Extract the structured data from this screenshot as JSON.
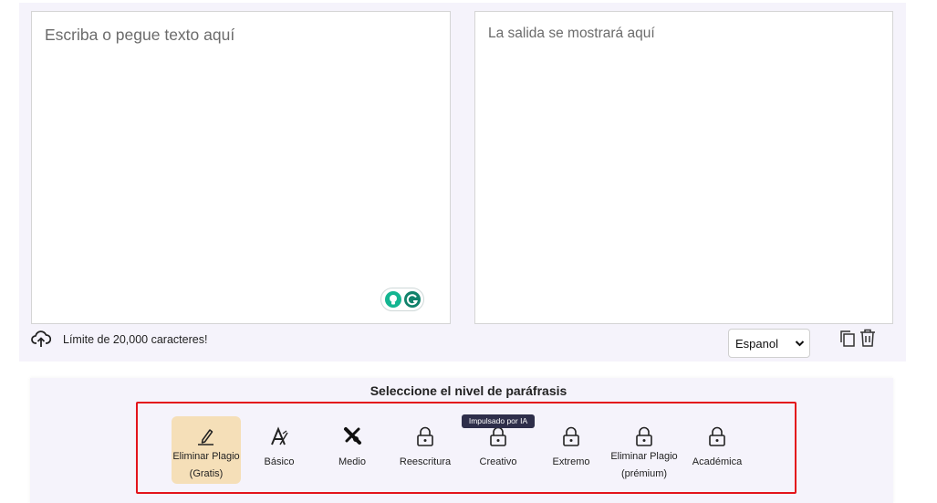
{
  "input": {
    "placeholder": "Escriba o pegue texto aquí"
  },
  "output": {
    "placeholder": "La salida se mostrará aquí"
  },
  "footer": {
    "limit_text": "Límite de 20,000 caracteres!",
    "language": "Espanol"
  },
  "paraphrase": {
    "title": "Seleccione el nivel de paráfrasis",
    "ai_badge": "Impulsado por IA",
    "levels": [
      {
        "line1": "Eliminar Plagio",
        "line2": "(Gratis)",
        "icon": "pen-icon",
        "locked": false,
        "selected": true
      },
      {
        "line1": "Básico",
        "line2": "",
        "icon": "basic-icon",
        "locked": false,
        "selected": false
      },
      {
        "line1": "Medio",
        "line2": "",
        "icon": "medium-icon",
        "locked": false,
        "selected": false
      },
      {
        "line1": "Reescritura",
        "line2": "",
        "icon": "lock-icon",
        "locked": true,
        "selected": false
      },
      {
        "line1": "Creativo",
        "line2": "",
        "icon": "lock-icon",
        "locked": true,
        "selected": false
      },
      {
        "line1": "Extremo",
        "line2": "",
        "icon": "lock-icon",
        "locked": true,
        "selected": false
      },
      {
        "line1": "Eliminar Plagio",
        "line2": "(prémium)",
        "icon": "lock-icon",
        "locked": true,
        "selected": false
      },
      {
        "line1": "Académica",
        "line2": "",
        "icon": "lock-icon",
        "locked": true,
        "selected": false
      }
    ]
  },
  "colors": {
    "panel_bg": "#f5f3fb",
    "selected_level_bg": "#f5dfb8",
    "highlight_frame": "#e3141b",
    "grammarly_green": "#11826b"
  }
}
